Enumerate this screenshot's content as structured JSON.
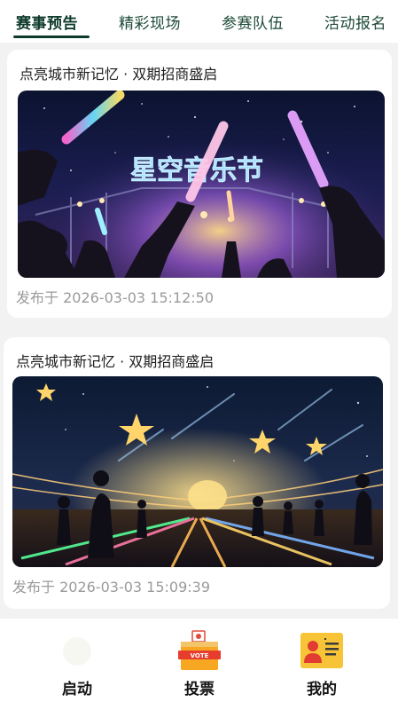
{
  "tabs": [
    {
      "label": "赛事预告",
      "active": true
    },
    {
      "label": "精彩现场",
      "active": false
    },
    {
      "label": "参赛队伍",
      "active": false
    },
    {
      "label": "活动报名",
      "active": false
    }
  ],
  "posts": [
    {
      "title": "点亮城市新记忆 · 双期招商盛启",
      "image_text": "星空音乐节",
      "date": "发布于 2026-03-03 15:12:50"
    },
    {
      "title": "点亮城市新记忆 · 双期招商盛启",
      "date": "发布于 2026-03-03 15:09:39"
    }
  ],
  "bottom_nav": [
    {
      "label": "启动",
      "icon": "launch-icon"
    },
    {
      "label": "投票",
      "icon": "vote-box-icon",
      "icon_text": "VOTE"
    },
    {
      "label": "我的",
      "icon": "profile-card-icon"
    }
  ],
  "colors": {
    "accent": "#0f3b2c",
    "date_text": "#9a9a9a",
    "background": "#f2f2f2"
  }
}
